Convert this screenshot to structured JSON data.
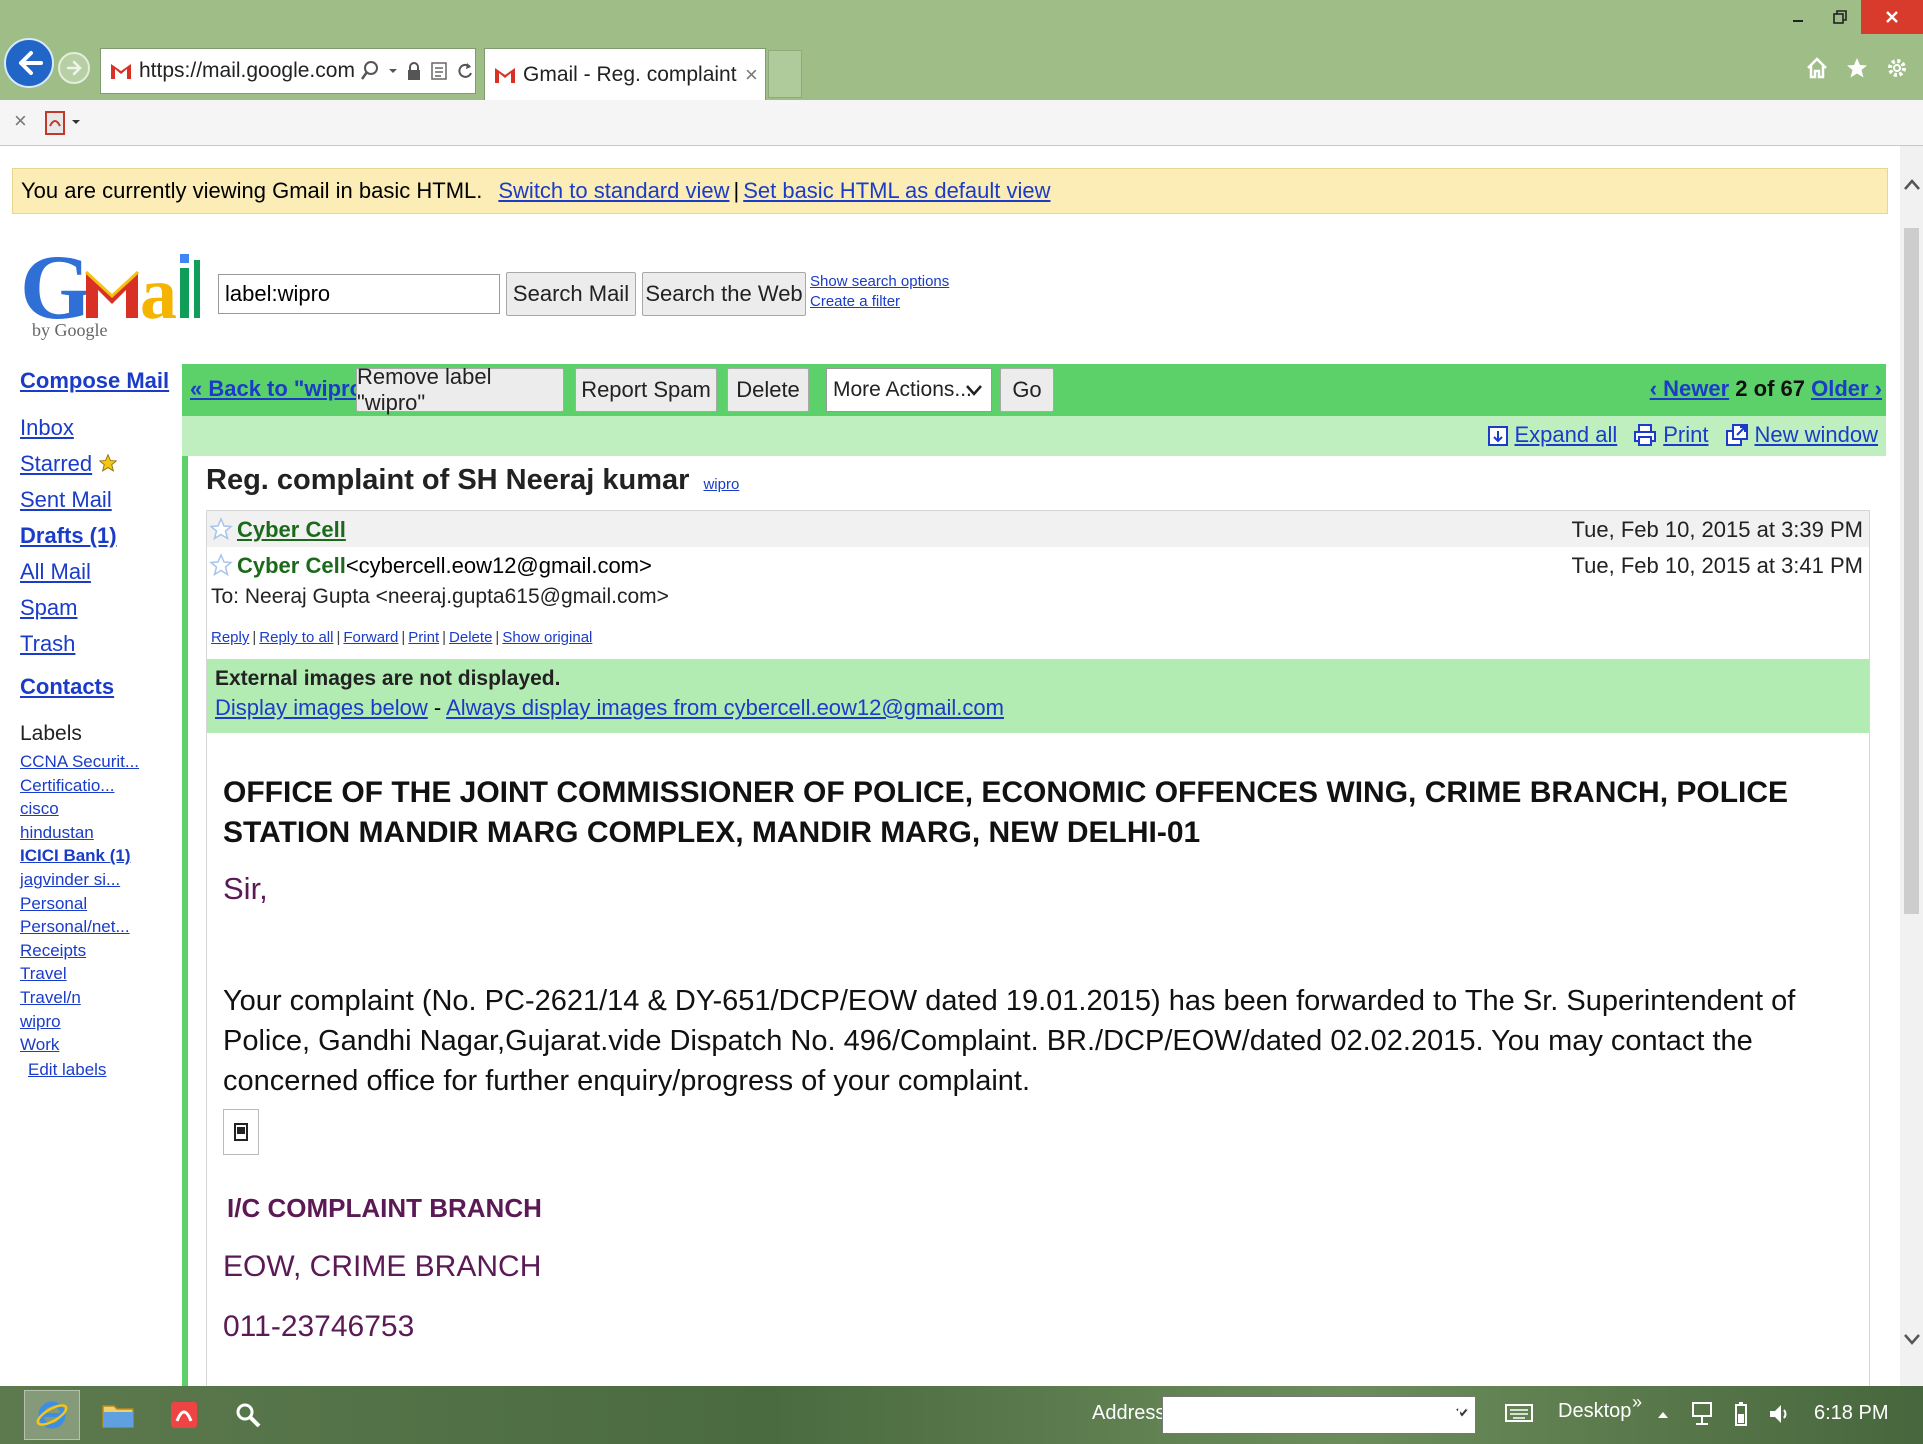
{
  "browser": {
    "url": "https://mail.google.com/mai",
    "tab_title": "Gmail - Reg. complaint of S...",
    "tab_close": "×"
  },
  "notice": {
    "text": "You are currently viewing Gmail in basic HTML.",
    "switch_link": "Switch to standard view",
    "separator": "|",
    "default_link": "Set basic HTML as default view"
  },
  "logo": {
    "by": "by Google"
  },
  "search": {
    "value": "label:wipro",
    "search_mail": "Search Mail",
    "search_web": "Search the Web",
    "show_options": "Show search options",
    "create_filter": "Create a filter"
  },
  "sidebar": {
    "compose": "Compose Mail",
    "items": [
      {
        "label": "Inbox"
      },
      {
        "label": "Starred"
      },
      {
        "label": "Sent Mail"
      },
      {
        "label": "Drafts (1)"
      },
      {
        "label": "All Mail"
      },
      {
        "label": "Spam"
      },
      {
        "label": "Trash"
      }
    ],
    "contacts": "Contacts",
    "labels_heading": "Labels",
    "labels": [
      "CCNA Securit...",
      "Certificatio...",
      "cisco",
      "hindustan",
      "ICICI Bank (1)",
      "jagvinder si...",
      "Personal",
      "Personal/net...",
      "Receipts",
      "Travel",
      "Travel/n",
      "wipro",
      "Work"
    ],
    "edit_labels": "Edit labels"
  },
  "toolbar": {
    "back": "« Back to \"wipro\"",
    "remove_label": "Remove label \"wipro\"",
    "report_spam": "Report Spam",
    "delete": "Delete",
    "more_actions": "More Actions...",
    "go": "Go",
    "newer": "‹ Newer",
    "position": " 2 of 67 ",
    "older": "Older ›",
    "expand_all": "Expand all",
    "print": "Print",
    "new_window": "New window"
  },
  "thread": {
    "subject": "Reg. complaint of SH Neeraj kumar",
    "label": "wipro",
    "msg1": {
      "sender": "Cyber Cell",
      "date": "Tue, Feb 10, 2015 at 3:39 PM"
    },
    "msg2": {
      "sender": "Cyber Cell",
      "email": "<cybercell.eow12@gmail.com>",
      "date": "Tue, Feb 10, 2015 at 3:41 PM",
      "to": "To: Neeraj Gupta <neeraj.gupta615@gmail.com>"
    },
    "actions": [
      "Reply",
      "Reply to all",
      "Forward",
      "Print",
      "Delete",
      "Show original"
    ],
    "external": {
      "title": "External images are not displayed.",
      "display_below": "Display images below",
      "dash": " - ",
      "always_display": "Always display images from cybercell.eow12@gmail.com"
    },
    "body": {
      "office": "OFFICE OF THE JOINT COMMISSIONER OF POLICE, ECONOMIC OFFENCES WING, CRIME BRANCH, POLICE STATION MANDIR MARG COMPLEX, MANDIR MARG, NEW DELHI-01",
      "greeting": "Sir,",
      "paragraph": "Your complaint (No. PC-2621/14 & DY-651/DCP/EOW dated 19.01.2015) has been forwarded to The Sr. Superintendent of Police, Gandhi Nagar,Gujarat.vide Dispatch No. 496/Complaint. BR./DCP/EOW/dated  02.02.2015. You may contact the concerned office for further enquiry/progress of your complaint.",
      "sig_line1": "I/C COMPLAINT BRANCH",
      "sig_line2": "EOW, CRIME BRANCH",
      "sig_line3": "011-23746753"
    }
  },
  "taskbar": {
    "address_label": "Address",
    "desktop": "Desktop",
    "chevrons": "»",
    "clock": "6:18 PM"
  },
  "colors": {
    "action_bar": "#5cd16a",
    "sub_bar": "#bfefbf",
    "notice_bg": "#fbedb5",
    "link": "#1a3cc8",
    "signature": "#5b1a55",
    "sender_green": "#1b6a1b"
  }
}
